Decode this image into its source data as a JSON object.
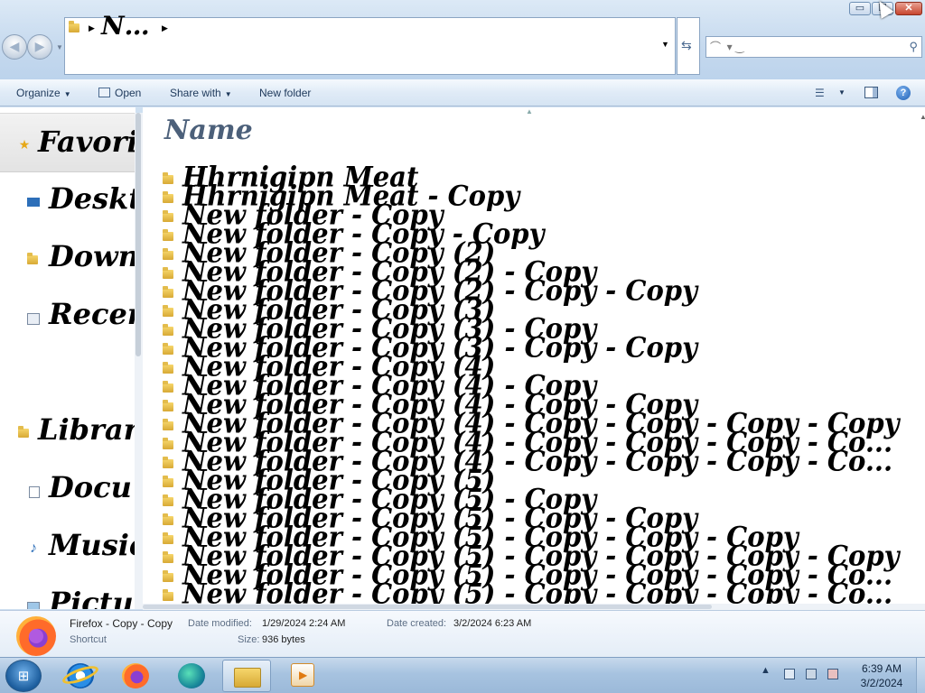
{
  "window": {
    "minimize": "▭",
    "maximize": "☐",
    "close": "✕"
  },
  "address": {
    "path": "N…",
    "search_placeholder": "⌒  ▾ ‿"
  },
  "toolbar": {
    "organize": "Organize",
    "open": "Open",
    "share_with": "Share with",
    "new_folder": "New folder",
    "help": "?"
  },
  "nav": {
    "favorites": "Favori",
    "desktop": "Deskt",
    "downloads": "Down",
    "recent": "Recen",
    "libraries": "Librar",
    "documents": "Docu",
    "music": "Music",
    "pictures": "Pictu"
  },
  "content": {
    "column_name": "Name",
    "files": [
      "Hhrnigipn Meat",
      "Hhrnigipn Meat - Copy",
      "New folder - Copy",
      "New folder - Copy - Copy",
      "New folder - Copy (2)",
      "New folder - Copy (2) - Copy",
      "New folder - Copy (2) - Copy - Copy",
      "New folder - Copy (3)",
      "New folder - Copy (3) - Copy",
      "New folder - Copy (3) - Copy - Copy",
      "New folder - Copy (4)",
      "New folder - Copy (4) - Copy",
      "New folder - Copy (4) - Copy - Copy",
      "New folder - Copy (4) - Copy - Copy - Copy - Copy",
      "New folder - Copy (4) - Copy - Copy - Copy - Co...",
      "New folder - Copy (4) - Copy - Copy - Copy - Co...",
      "New folder - Copy (5)",
      "New folder - Copy (5) - Copy",
      "New folder - Copy (5) - Copy - Copy",
      "New folder - Copy (5) - Copy - Copy - Copy",
      "New folder - Copy (5) - Copy - Copy - Copy - Copy",
      "New folder - Copy (5) - Copy - Copy - Copy - Co...",
      "New folder - Copy (5) - Copy - Copy - Copy - Co..."
    ]
  },
  "details": {
    "name": "Firefox - Copy - Copy",
    "type": "Shortcut",
    "date_modified_label": "Date modified:",
    "date_modified": "1/29/2024 2:24 AM",
    "date_created_label": "Date created:",
    "date_created": "3/2/2024 6:23 AM",
    "size_label": "Size:",
    "size": "936 bytes"
  },
  "taskbar": {
    "start_glyph": "⊞",
    "tray_arrow": "▲",
    "time": "6:39 AM",
    "date": "3/2/2024"
  }
}
